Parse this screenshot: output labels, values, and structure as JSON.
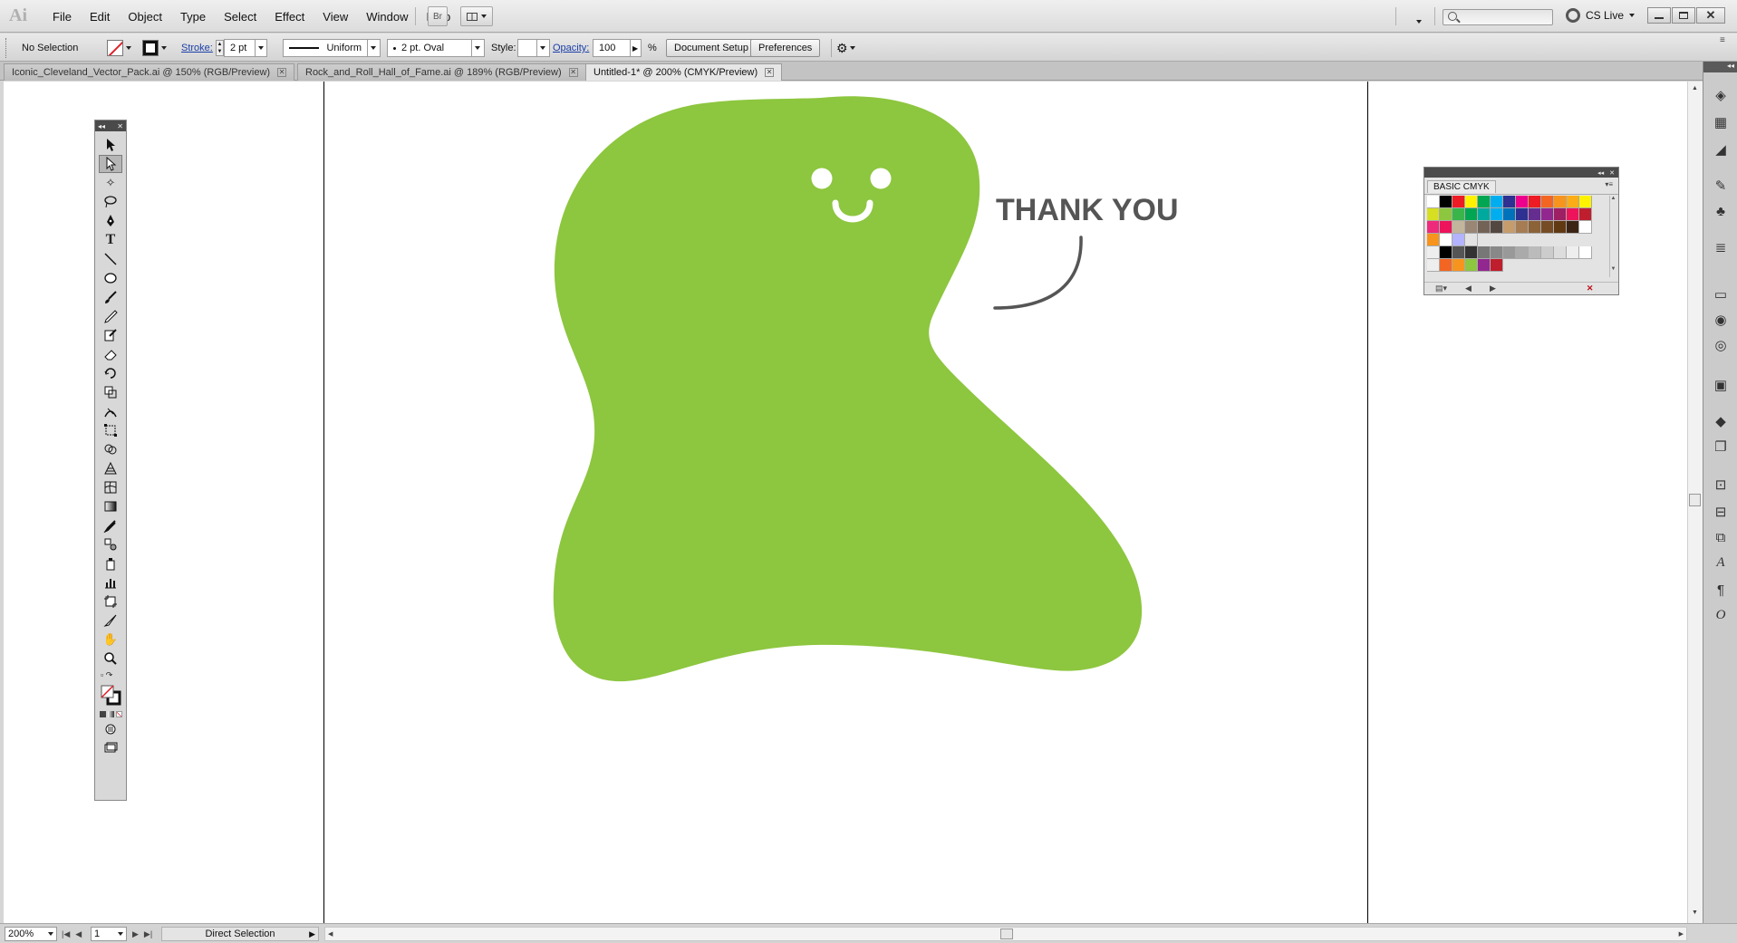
{
  "app": {
    "logo": "Ai",
    "menus": [
      "File",
      "Edit",
      "Object",
      "Type",
      "Select",
      "Effect",
      "View",
      "Window",
      "Help"
    ],
    "bridge_label": "Br",
    "cslive": "CS Live"
  },
  "control": {
    "selection": "No Selection",
    "stroke_label": "Stroke:",
    "stroke_weight": "2 pt",
    "stroke_profile": "Uniform",
    "brush": "2 pt. Oval",
    "style_label": "Style:",
    "opacity_label": "Opacity:",
    "opacity_value": "100",
    "opacity_unit": "%",
    "doc_setup": "Document Setup",
    "preferences": "Preferences"
  },
  "tabs": [
    {
      "label": "Iconic_Cleveland_Vector_Pack.ai @ 150% (RGB/Preview)",
      "active": false
    },
    {
      "label": "Rock_and_Roll_Hall_of_Fame.ai @ 189% (RGB/Preview)",
      "active": false
    },
    {
      "label": "Untitled-1* @ 200% (CMYK/Preview)",
      "active": true
    }
  ],
  "artwork": {
    "caption": "THANK YOU",
    "blob_color": "#8dc63f",
    "caption_color": "#555555"
  },
  "swatches": {
    "title": "BASIC CMYK"
  },
  "status": {
    "zoom": "200%",
    "page": "1",
    "tool": "Direct Selection"
  }
}
